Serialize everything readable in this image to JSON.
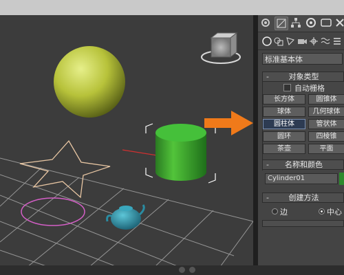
{
  "viewport": {
    "objects": [
      "sphere",
      "star-shape",
      "cylinder",
      "circle-shape",
      "teapot"
    ],
    "annotation_arrow_color": "#f07a1a"
  },
  "panel": {
    "primitive_type": "标准基本体",
    "object_type": {
      "header": "对象类型",
      "autogrid_label": "自动栅格",
      "buttons": [
        "长方体",
        "圆锥体",
        "球体",
        "几何球体",
        "圆柱体",
        "管状体",
        "圆环",
        "四棱锥",
        "茶壶",
        "平面"
      ],
      "active": "圆柱体"
    },
    "name_color": {
      "header": "名称和颜色",
      "name_value": "Cylinder01",
      "color": "#2d8a2d"
    },
    "creation_method": {
      "header": "创建方法",
      "options": [
        "边",
        "中心"
      ],
      "selected": "中心"
    }
  }
}
